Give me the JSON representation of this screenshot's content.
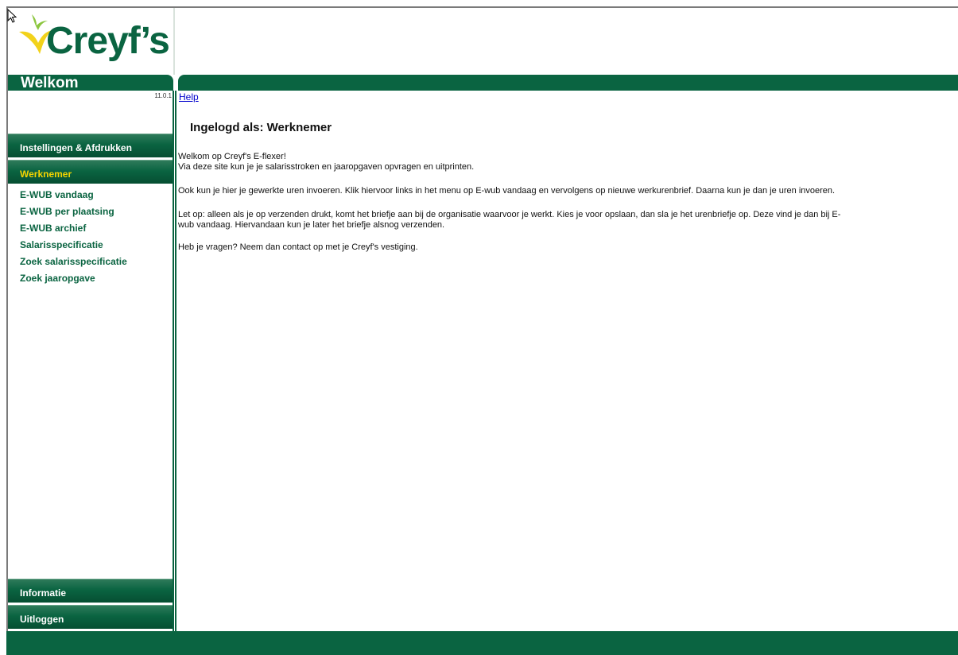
{
  "brand": {
    "name": "Creyf’s"
  },
  "header": {
    "welcome": "Welkom",
    "version": "11.0.1"
  },
  "menu": {
    "settings_label": "Instellingen & Afdrukken",
    "employee_label": "Werknemer",
    "items": [
      {
        "label": "E-WUB vandaag"
      },
      {
        "label": "E-WUB per plaatsing"
      },
      {
        "label": "E-WUB archief"
      },
      {
        "label": "Salarisspecificatie"
      },
      {
        "label": "Zoek salarisspecificatie"
      },
      {
        "label": "Zoek jaaropgave"
      }
    ],
    "info_label": "Informatie",
    "logout_label": "Uitloggen"
  },
  "content": {
    "help_label": "Help",
    "heading": "Ingelogd als: Werknemer",
    "p1_line1": "Welkom op Creyf's E-flexer!",
    "p1_line2": "Via deze site kun je je salarisstroken en jaaropgaven opvragen en uitprinten.",
    "p2": "Ook kun je hier je gewerkte uren invoeren. Klik hiervoor links in het menu op E-wub vandaag en vervolgens op nieuwe werkurenbrief. Daarna kun je dan je uren invoeren.",
    "p3_line1": "Let op: alleen als je op verzenden drukt, komt het briefje aan bij de organisatie waarvoor je werkt. Kies je voor opslaan, dan sla je het urenbriefje op. Deze vind je dan bij E-",
    "p3_line2": "wub vandaag. Hiervandaan kun je later het briefje alsnog verzenden.",
    "p4": "Heb je vragen? Neem dan contact op met je Creyf's vestiging."
  },
  "colors": {
    "brand_green": "#0a6441",
    "accent_yellow": "#f5d400",
    "link_blue": "#0000cc"
  },
  "icons": {
    "logo_bird": "swallow-bird-icon",
    "cursor": "mouse-pointer-icon"
  }
}
